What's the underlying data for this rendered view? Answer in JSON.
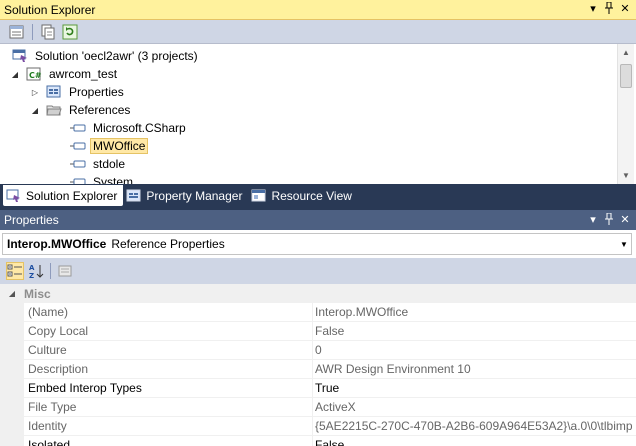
{
  "solution_explorer": {
    "title": "Solution Explorer",
    "controls": {
      "dropdown": "▾",
      "pin": "📌",
      "close": "✕"
    },
    "tree": [
      {
        "label": "Solution 'oecl2awr' (3 projects)",
        "icon": "solution-icon",
        "level": 0,
        "expander": ""
      },
      {
        "label": "awrcom_test",
        "icon": "cpp-project-icon",
        "level": 1,
        "expander": "expanded"
      },
      {
        "label": "Properties",
        "icon": "properties-icon",
        "level": 2,
        "expander": "collapsed"
      },
      {
        "label": "References",
        "icon": "folder-icon",
        "level": 2,
        "expander": "expanded"
      },
      {
        "label": "Microsoft.CSharp",
        "icon": "reference-icon",
        "level": 3,
        "expander": ""
      },
      {
        "label": "MWOffice",
        "icon": "reference-icon",
        "level": 3,
        "expander": "",
        "selected": true
      },
      {
        "label": "stdole",
        "icon": "reference-icon",
        "level": 3,
        "expander": ""
      },
      {
        "label": "System",
        "icon": "reference-icon",
        "level": 3,
        "expander": ""
      }
    ]
  },
  "tabs": [
    {
      "label": "Solution Explorer",
      "icon": "solution-explorer-icon",
      "active": true
    },
    {
      "label": "Property Manager",
      "icon": "property-manager-icon",
      "active": false
    },
    {
      "label": "Resource View",
      "icon": "resource-view-icon",
      "active": false
    }
  ],
  "properties": {
    "title": "Properties",
    "object_name": "Interop.MWOffice",
    "object_type": "Reference Properties",
    "category": "Misc",
    "rows": [
      {
        "name": "(Name)",
        "value": "Interop.MWOffice",
        "editable": false
      },
      {
        "name": "Copy Local",
        "value": "False",
        "editable": false
      },
      {
        "name": "Culture",
        "value": "0",
        "editable": false
      },
      {
        "name": "Description",
        "value": "AWR Design Environment 10",
        "editable": false
      },
      {
        "name": "Embed Interop Types",
        "value": "True",
        "editable": true
      },
      {
        "name": "File Type",
        "value": "ActiveX",
        "editable": false
      },
      {
        "name": "Identity",
        "value": "{5AE2215C-270C-470B-A2B6-609A964E53A2}\\a.0\\0\\tlbimp",
        "editable": false
      },
      {
        "name": "Isolated",
        "value": "False",
        "editable": true
      }
    ]
  },
  "colors": {
    "title_active": "#fff29d",
    "title_inactive": "#4d6082",
    "frame": "#293955",
    "toolbar": "#cfd6e5",
    "selection": "#ffe8a6"
  }
}
